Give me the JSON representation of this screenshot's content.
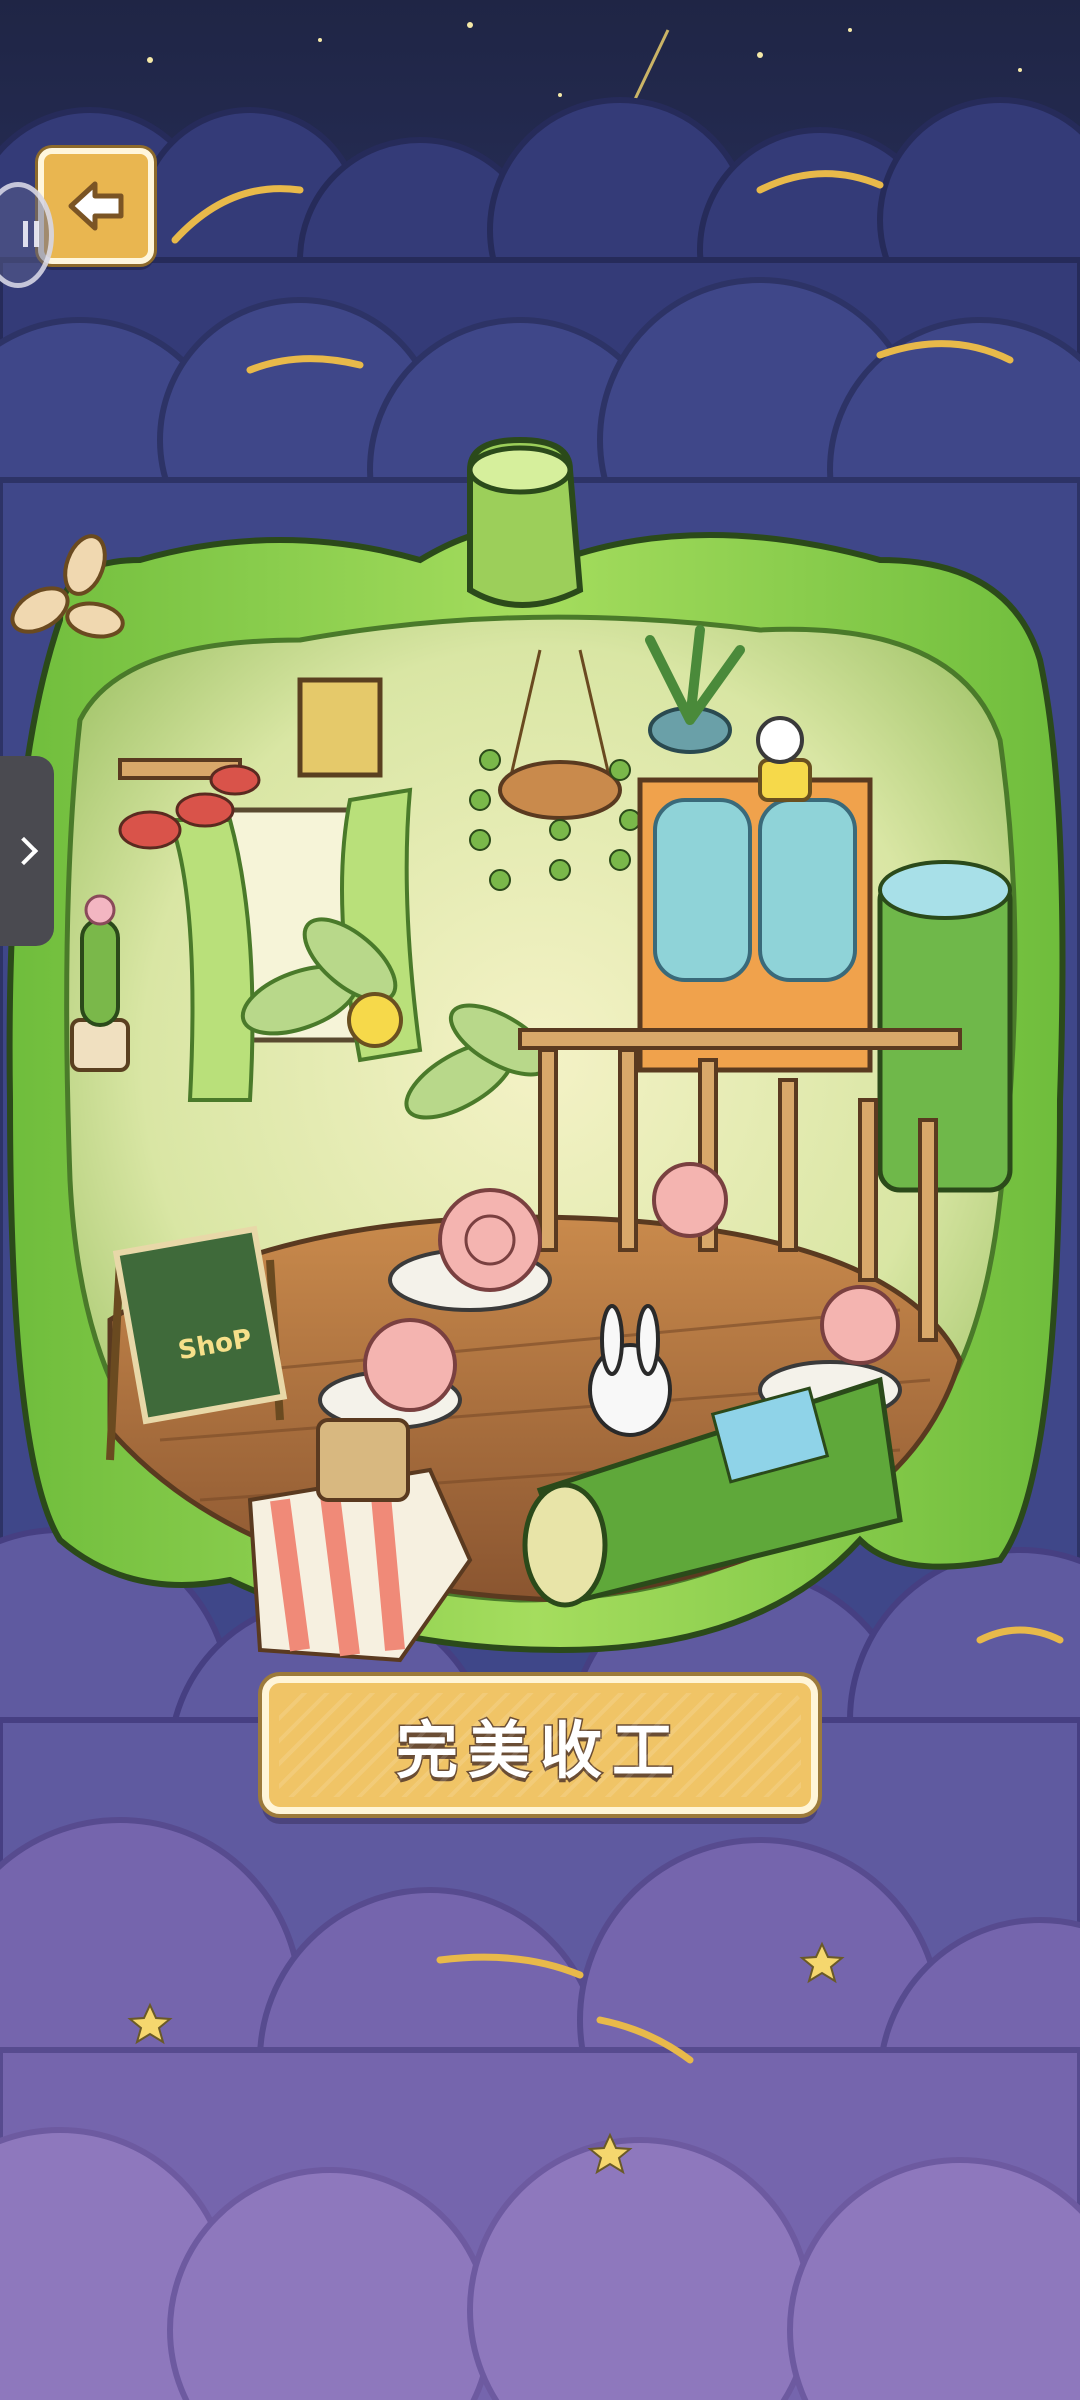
{
  "screen": {
    "finish_button": {
      "label": "完美收工"
    },
    "shop_sign": {
      "text": "ShoP"
    }
  },
  "icons": {
    "back": "arrow-left-icon",
    "sound": "pause-icon",
    "side_tab": "chevron-right-icon"
  },
  "colors": {
    "sky_top": "#1f2545",
    "cloud": "#3f4789",
    "pepper_green": "#8fd24e",
    "button_gold": "#f0c466",
    "button_border": "#fff5d8",
    "star": "#f5d76e"
  }
}
